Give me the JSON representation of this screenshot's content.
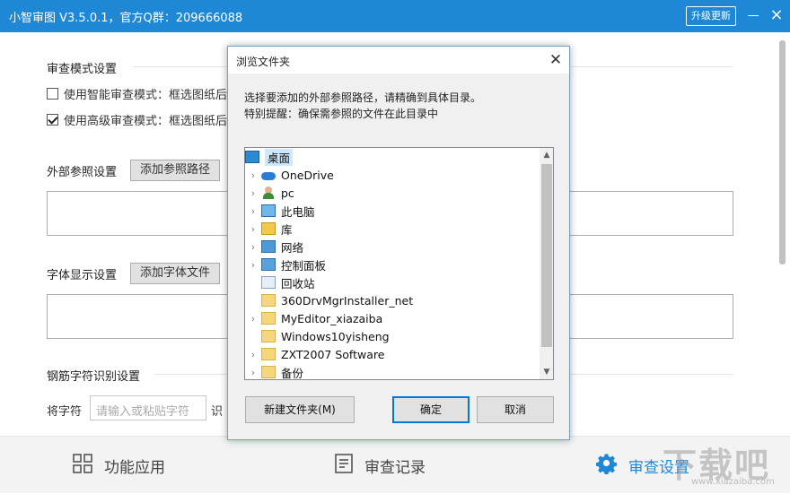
{
  "app": {
    "title": "小智审图 V3.5.0.1，官方Q群：209666088",
    "upgrade_label": "升级更新",
    "close_glyph": "×"
  },
  "main": {
    "review_mode": {
      "title": "审查模式设置",
      "options": [
        {
          "label": "使用智能审查模式：框选图纸后",
          "checked": false
        },
        {
          "label": "使用高级审查模式：框选图纸后",
          "checked": true
        }
      ]
    },
    "external_ref": {
      "title": "外部参照设置",
      "add_button": "添加参照路径"
    },
    "font_display": {
      "title": "字体显示设置",
      "add_button": "添加字体文件"
    },
    "rebar": {
      "title": "钢筋字符识别设置",
      "char_label": "将字符",
      "char_placeholder": "请输入或粘贴字符",
      "recognize_label": "识"
    }
  },
  "bottom_nav": {
    "items": [
      {
        "label": "功能应用",
        "icon": "grid-icon",
        "active": false
      },
      {
        "label": "审查记录",
        "icon": "document-icon",
        "active": false
      },
      {
        "label": "审查设置",
        "icon": "gear-icon",
        "active": true
      }
    ]
  },
  "dialog": {
    "title": "浏览文件夹",
    "close_glyph": "✕",
    "message_line1": "选择要添加的外部参照路径，请精确到具体目录。",
    "message_line2": "特别提醒：确保需参照的文件在此目录中",
    "tree": [
      {
        "label": "桌面",
        "icon": "desktop-icon",
        "expandable": false,
        "selected": true
      },
      {
        "label": "OneDrive",
        "icon": "onedrive-icon",
        "expandable": true
      },
      {
        "label": "pc",
        "icon": "user-icon",
        "expandable": true
      },
      {
        "label": "此电脑",
        "icon": "computer-icon",
        "expandable": true
      },
      {
        "label": "库",
        "icon": "library-icon",
        "expandable": true
      },
      {
        "label": "网络",
        "icon": "network-icon",
        "expandable": true
      },
      {
        "label": "控制面板",
        "icon": "control-panel-icon",
        "expandable": true
      },
      {
        "label": "回收站",
        "icon": "recycle-bin-icon",
        "expandable": false
      },
      {
        "label": "360DrvMgrInstaller_net",
        "icon": "folder-icon",
        "expandable": false
      },
      {
        "label": "MyEditor_xiazaiba",
        "icon": "folder-icon",
        "expandable": true
      },
      {
        "label": "Windows10yisheng",
        "icon": "folder-icon",
        "expandable": false
      },
      {
        "label": "ZXT2007 Software",
        "icon": "folder-icon",
        "expandable": true
      },
      {
        "label": "备份",
        "icon": "folder-icon",
        "expandable": true
      }
    ],
    "new_folder_button": "新建文件夹(M)",
    "ok_button": "确定",
    "cancel_button": "取消"
  },
  "watermark": {
    "text": "下载吧",
    "sub": "www.xiazaiba.com"
  },
  "colors": {
    "accent": "#1e88d6",
    "selection": "#cce8ff"
  }
}
